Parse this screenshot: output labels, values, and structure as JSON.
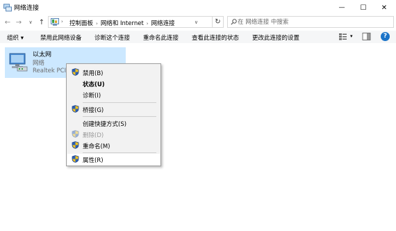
{
  "window": {
    "title": "网络连接",
    "minimize_glyph": "—",
    "maximize_glyph": "☐",
    "close_glyph": "✕"
  },
  "navigation": {
    "back_glyph": "←",
    "forward_glyph": "→",
    "recent_glyph": "∨",
    "up_glyph": "↑",
    "breadcrumb": [
      "控制面板",
      "网络和 Internet",
      "网络连接"
    ],
    "refresh_glyph": "↻",
    "search_placeholder": "在 网络连接 中搜索"
  },
  "toolbar": {
    "items": [
      "组织 ▾",
      "禁用此网络设备",
      "诊断这个连接",
      "重命名此连接",
      "查看此连接的状态",
      "更改此连接的设置"
    ],
    "view_arrow": "▾",
    "help_glyph": "?"
  },
  "connection": {
    "name": "以太网",
    "status": "网络",
    "adapter": "Realtek PCIe"
  },
  "context_menu": {
    "items": [
      {
        "label": "禁用(B)",
        "icon": "shield-icon",
        "style": "normal"
      },
      {
        "label": "状态(U)",
        "icon": "",
        "style": "bold"
      },
      {
        "label": "诊断(I)",
        "icon": "",
        "style": "normal"
      },
      {
        "label": "桥接(G)",
        "icon": "shield-icon",
        "style": "normal"
      },
      {
        "label": "创建快捷方式(S)",
        "icon": "",
        "style": "normal"
      },
      {
        "label": "删除(D)",
        "icon": "shield-icon",
        "style": "disabled"
      },
      {
        "label": "重命名(M)",
        "icon": "shield-icon",
        "style": "normal"
      },
      {
        "label": "属性(R)",
        "icon": "shield-icon",
        "style": "hover"
      }
    ]
  },
  "colors": {
    "selection": "#cce8ff",
    "help_blue": "#1a73c8",
    "shield_blue": "#2b5fb5",
    "shield_yellow": "#f3c21b"
  }
}
